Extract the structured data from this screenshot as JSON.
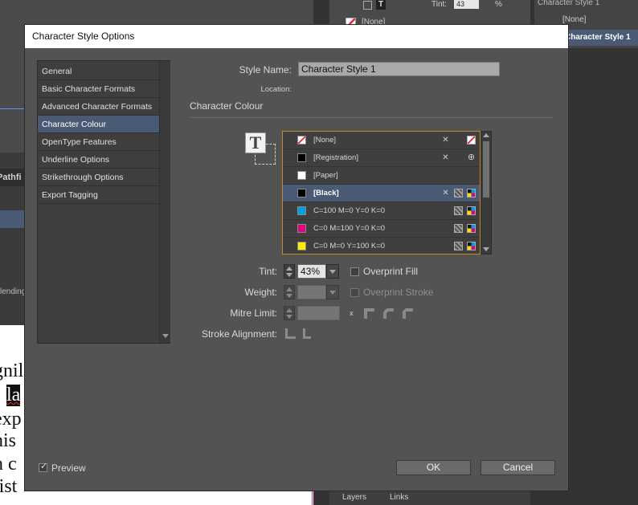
{
  "background": {
    "pathfinder_tab": "Pathfi",
    "blending_label": "lending",
    "tint_label": "Tint:",
    "tint_value": "43",
    "percent": "%",
    "swatch_none": "[None]",
    "styles_header": "Character Style 1",
    "styles_none": "[None]",
    "styles_selected": "Character Style 1",
    "layers_tab": "Layers",
    "links_tab": "Links",
    "doc_lines": [
      "gnil",
      "la",
      "exp",
      "nis",
      "n c",
      "list"
    ]
  },
  "dialog": {
    "title": "Character Style Options",
    "categories": [
      {
        "label": "General"
      },
      {
        "label": "Basic Character Formats"
      },
      {
        "label": "Advanced Character Formats"
      },
      {
        "label": "Character Colour"
      },
      {
        "label": "OpenType Features"
      },
      {
        "label": "Underline Options"
      },
      {
        "label": "Strikethrough Options"
      },
      {
        "label": "Export Tagging"
      }
    ],
    "selected_category": "Character Colour",
    "style_name_label": "Style Name:",
    "style_name_value": "Character Style 1",
    "location_label": "Location:",
    "section_heading": "Character Colour",
    "fill_icon_glyph": "T",
    "swatches": [
      {
        "name": "[None]",
        "color": "none"
      },
      {
        "name": "[Registration]",
        "color": "#000000"
      },
      {
        "name": "[Paper]",
        "color": "#ffffff"
      },
      {
        "name": "[Black]",
        "color": "#000000"
      },
      {
        "name": "C=100 M=0 Y=0 K=0",
        "color": "#00a0e3"
      },
      {
        "name": "C=0 M=100 Y=0 K=0",
        "color": "#e6007e"
      },
      {
        "name": "C=0 M=0 Y=100 K=0",
        "color": "#ffed00"
      }
    ],
    "selected_swatch": "[Black]",
    "tint_label": "Tint:",
    "tint_value": "43%",
    "overprint_fill_label": "Overprint Fill",
    "weight_label": "Weight:",
    "overprint_stroke_label": "Overprint Stroke",
    "mitre_label": "Mitre Limit:",
    "mitre_x": "x",
    "stroke_alignment_label": "Stroke Alignment:",
    "preview_label": "Preview",
    "preview_checked": true,
    "ok_label": "OK",
    "cancel_label": "Cancel"
  },
  "colors": {
    "selection": "#4a5a74",
    "swatch_list_border": "#c8862f",
    "dialog_bg": "#535353"
  }
}
